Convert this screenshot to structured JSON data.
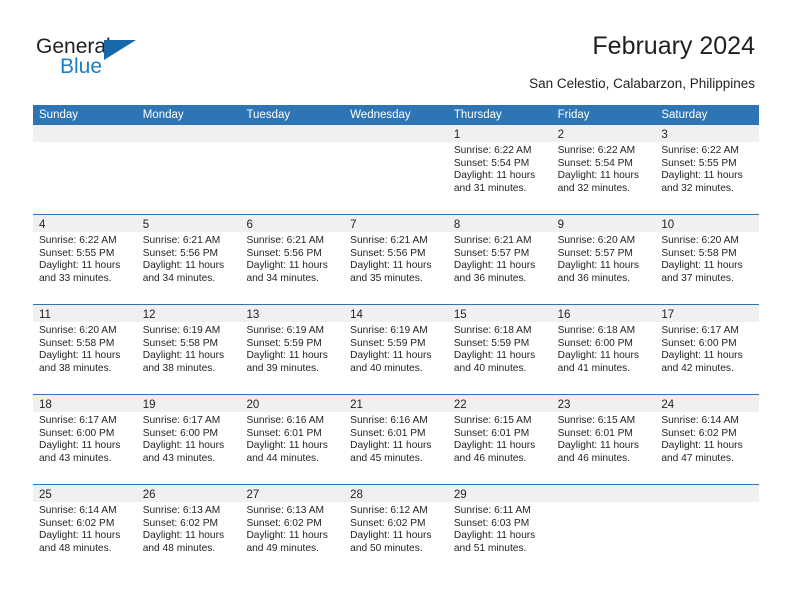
{
  "brand": {
    "name_part1": "General",
    "name_part2": "Blue"
  },
  "header": {
    "title": "February 2024",
    "subtitle": "San Celestio, Calabarzon, Philippines"
  },
  "calendar": {
    "day_headers": [
      "Sunday",
      "Monday",
      "Tuesday",
      "Wednesday",
      "Thursday",
      "Friday",
      "Saturday"
    ],
    "labels": {
      "sunrise": "Sunrise:",
      "sunset": "Sunset:",
      "daylight": "Daylight:"
    },
    "colors": {
      "header_blue": "#2e75b6",
      "daynum_band": "#f0f0f0",
      "text": "#231f20",
      "logo_blue": "#1c7fc4"
    },
    "weeks": [
      [
        {
          "day": "",
          "empty": true
        },
        {
          "day": "",
          "empty": true
        },
        {
          "day": "",
          "empty": true
        },
        {
          "day": "",
          "empty": true
        },
        {
          "day": "1",
          "sunrise": "Sunrise: 6:22 AM",
          "sunset": "Sunset: 5:54 PM",
          "daylight": "Daylight: 11 hours and 31 minutes."
        },
        {
          "day": "2",
          "sunrise": "Sunrise: 6:22 AM",
          "sunset": "Sunset: 5:54 PM",
          "daylight": "Daylight: 11 hours and 32 minutes."
        },
        {
          "day": "3",
          "sunrise": "Sunrise: 6:22 AM",
          "sunset": "Sunset: 5:55 PM",
          "daylight": "Daylight: 11 hours and 32 minutes."
        }
      ],
      [
        {
          "day": "4",
          "sunrise": "Sunrise: 6:22 AM",
          "sunset": "Sunset: 5:55 PM",
          "daylight": "Daylight: 11 hours and 33 minutes."
        },
        {
          "day": "5",
          "sunrise": "Sunrise: 6:21 AM",
          "sunset": "Sunset: 5:56 PM",
          "daylight": "Daylight: 11 hours and 34 minutes."
        },
        {
          "day": "6",
          "sunrise": "Sunrise: 6:21 AM",
          "sunset": "Sunset: 5:56 PM",
          "daylight": "Daylight: 11 hours and 34 minutes."
        },
        {
          "day": "7",
          "sunrise": "Sunrise: 6:21 AM",
          "sunset": "Sunset: 5:56 PM",
          "daylight": "Daylight: 11 hours and 35 minutes."
        },
        {
          "day": "8",
          "sunrise": "Sunrise: 6:21 AM",
          "sunset": "Sunset: 5:57 PM",
          "daylight": "Daylight: 11 hours and 36 minutes."
        },
        {
          "day": "9",
          "sunrise": "Sunrise: 6:20 AM",
          "sunset": "Sunset: 5:57 PM",
          "daylight": "Daylight: 11 hours and 36 minutes."
        },
        {
          "day": "10",
          "sunrise": "Sunrise: 6:20 AM",
          "sunset": "Sunset: 5:58 PM",
          "daylight": "Daylight: 11 hours and 37 minutes."
        }
      ],
      [
        {
          "day": "11",
          "sunrise": "Sunrise: 6:20 AM",
          "sunset": "Sunset: 5:58 PM",
          "daylight": "Daylight: 11 hours and 38 minutes."
        },
        {
          "day": "12",
          "sunrise": "Sunrise: 6:19 AM",
          "sunset": "Sunset: 5:58 PM",
          "daylight": "Daylight: 11 hours and 38 minutes."
        },
        {
          "day": "13",
          "sunrise": "Sunrise: 6:19 AM",
          "sunset": "Sunset: 5:59 PM",
          "daylight": "Daylight: 11 hours and 39 minutes."
        },
        {
          "day": "14",
          "sunrise": "Sunrise: 6:19 AM",
          "sunset": "Sunset: 5:59 PM",
          "daylight": "Daylight: 11 hours and 40 minutes."
        },
        {
          "day": "15",
          "sunrise": "Sunrise: 6:18 AM",
          "sunset": "Sunset: 5:59 PM",
          "daylight": "Daylight: 11 hours and 40 minutes."
        },
        {
          "day": "16",
          "sunrise": "Sunrise: 6:18 AM",
          "sunset": "Sunset: 6:00 PM",
          "daylight": "Daylight: 11 hours and 41 minutes."
        },
        {
          "day": "17",
          "sunrise": "Sunrise: 6:17 AM",
          "sunset": "Sunset: 6:00 PM",
          "daylight": "Daylight: 11 hours and 42 minutes."
        }
      ],
      [
        {
          "day": "18",
          "sunrise": "Sunrise: 6:17 AM",
          "sunset": "Sunset: 6:00 PM",
          "daylight": "Daylight: 11 hours and 43 minutes."
        },
        {
          "day": "19",
          "sunrise": "Sunrise: 6:17 AM",
          "sunset": "Sunset: 6:00 PM",
          "daylight": "Daylight: 11 hours and 43 minutes."
        },
        {
          "day": "20",
          "sunrise": "Sunrise: 6:16 AM",
          "sunset": "Sunset: 6:01 PM",
          "daylight": "Daylight: 11 hours and 44 minutes."
        },
        {
          "day": "21",
          "sunrise": "Sunrise: 6:16 AM",
          "sunset": "Sunset: 6:01 PM",
          "daylight": "Daylight: 11 hours and 45 minutes."
        },
        {
          "day": "22",
          "sunrise": "Sunrise: 6:15 AM",
          "sunset": "Sunset: 6:01 PM",
          "daylight": "Daylight: 11 hours and 46 minutes."
        },
        {
          "day": "23",
          "sunrise": "Sunrise: 6:15 AM",
          "sunset": "Sunset: 6:01 PM",
          "daylight": "Daylight: 11 hours and 46 minutes."
        },
        {
          "day": "24",
          "sunrise": "Sunrise: 6:14 AM",
          "sunset": "Sunset: 6:02 PM",
          "daylight": "Daylight: 11 hours and 47 minutes."
        }
      ],
      [
        {
          "day": "25",
          "sunrise": "Sunrise: 6:14 AM",
          "sunset": "Sunset: 6:02 PM",
          "daylight": "Daylight: 11 hours and 48 minutes."
        },
        {
          "day": "26",
          "sunrise": "Sunrise: 6:13 AM",
          "sunset": "Sunset: 6:02 PM",
          "daylight": "Daylight: 11 hours and 48 minutes."
        },
        {
          "day": "27",
          "sunrise": "Sunrise: 6:13 AM",
          "sunset": "Sunset: 6:02 PM",
          "daylight": "Daylight: 11 hours and 49 minutes."
        },
        {
          "day": "28",
          "sunrise": "Sunrise: 6:12 AM",
          "sunset": "Sunset: 6:02 PM",
          "daylight": "Daylight: 11 hours and 50 minutes."
        },
        {
          "day": "29",
          "sunrise": "Sunrise: 6:11 AM",
          "sunset": "Sunset: 6:03 PM",
          "daylight": "Daylight: 11 hours and 51 minutes."
        },
        {
          "day": "",
          "empty": true
        },
        {
          "day": "",
          "empty": true
        }
      ]
    ]
  }
}
